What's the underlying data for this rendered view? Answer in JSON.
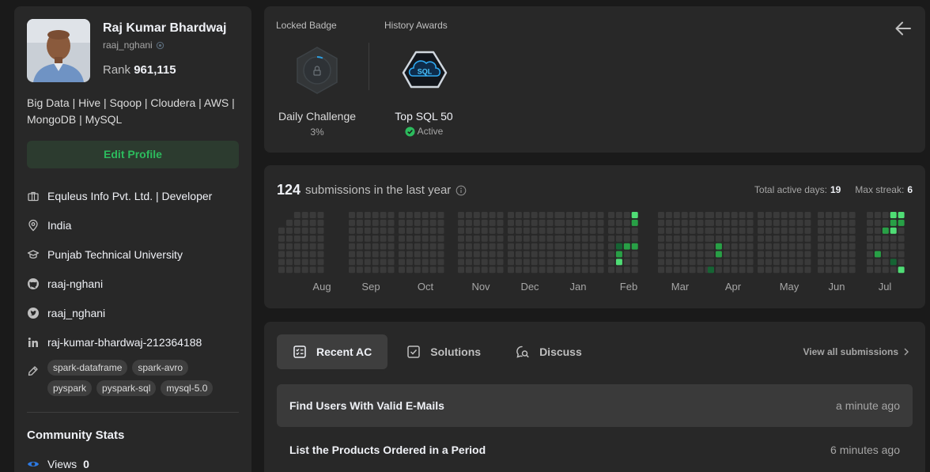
{
  "profile": {
    "name": "Raj Kumar Bhardwaj",
    "username": "raaj_nghani",
    "rank_label": "Rank",
    "rank_value": "961,115",
    "about": "Big Data | Hive | Sqoop | Cloudera | AWS | MongoDB | MySQL",
    "edit_label": "Edit Profile",
    "company": "Equleus Info Pvt. Ltd. | Developer",
    "location": "India",
    "school": "Punjab Technical University",
    "github": "raaj-nghani",
    "twitter": "raaj_nghani",
    "linkedin": "raj-kumar-bhardwaj-212364188",
    "skills": [
      "spark-dataframe",
      "spark-avro",
      "pyspark",
      "pyspark-sql",
      "mysql-5.0"
    ],
    "community_title": "Community Stats",
    "views_label": "Views",
    "views_value": "0"
  },
  "badges": {
    "locked_label": "Locked Badge",
    "history_label": "History Awards",
    "locked_name": "Daily Challenge",
    "locked_progress": "3%",
    "award_name": "Top SQL 50",
    "award_icon_text": "SQL",
    "award_status": "Active"
  },
  "heatmap": {
    "count": "124",
    "title_suffix": "submissions in the last year",
    "active_days_label": "Total active days:",
    "active_days": "19",
    "streak_label": "Max streak:",
    "streak": "6",
    "months": [
      "Aug",
      "Sep",
      "Oct",
      "Nov",
      "Dec",
      "Jan",
      "Feb",
      "Mar",
      "Apr",
      "May",
      "Jun",
      "Jul"
    ],
    "colors": {
      "empty": "#3a3a3a",
      "low": "#166434",
      "mid": "#28a046",
      "high": "#4fdd75"
    }
  },
  "recent": {
    "tabs": [
      "Recent AC",
      "Solutions",
      "Discuss"
    ],
    "view_all": "View all submissions",
    "items": [
      {
        "title": "Find Users With Valid E-Mails",
        "time": "a minute ago"
      },
      {
        "title": "List the Products Ordered in a Period",
        "time": "6 minutes ago"
      }
    ]
  }
}
